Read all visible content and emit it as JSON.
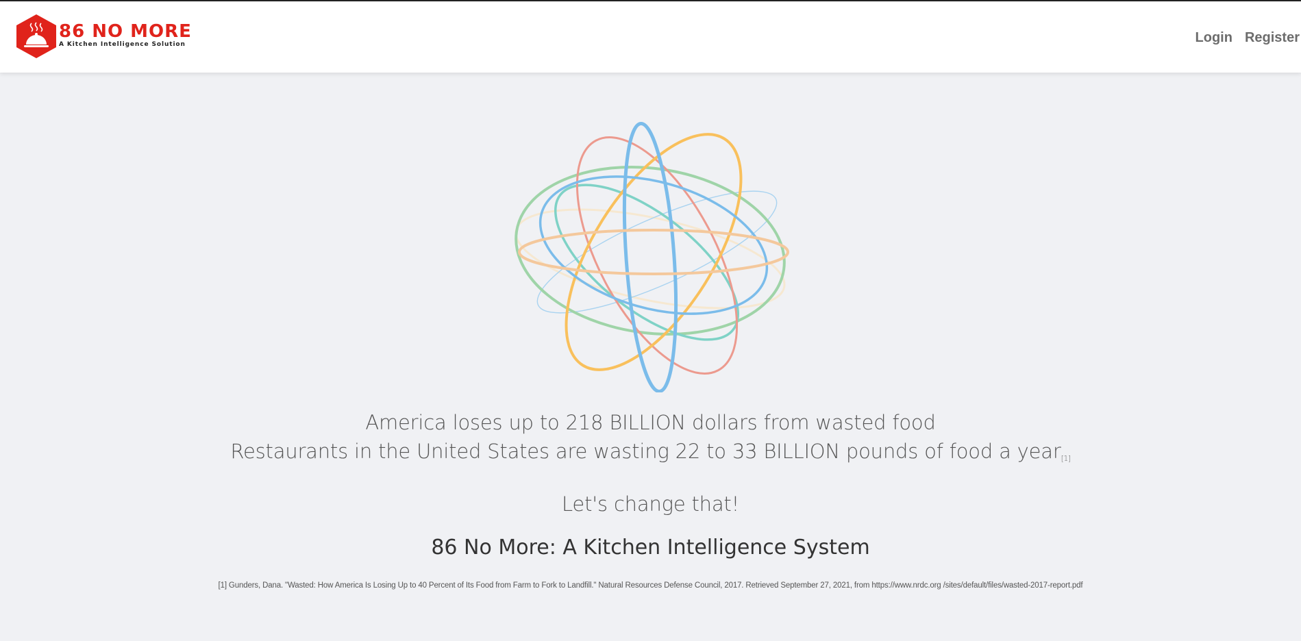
{
  "brand": {
    "name": "86 NO MORE",
    "tagline": "A Kitchen Intelligence Solution",
    "color": "#e0231b"
  },
  "nav": {
    "login_label": "Login",
    "register_label": "Register"
  },
  "hero": {
    "line1": "America loses up to 218 BILLION dollars from wasted food",
    "line2": "Restaurants in the United States are wasting 22 to 33 BILLION pounds of food a year",
    "citation_marker": "[1]",
    "call_to_action": "Let's change that!",
    "system_title": "86 No More: A Kitchen Intelligence System"
  },
  "footnote": "[1] Gunders, Dana. \"Wasted: How America Is Losing Up to 40 Percent of Its Food from Farm to Fork to Landfill.\" Natural Resources Defense Council, 2017. Retrieved September 27, 2021, from https://www.nrdc.org /sites/default/files/wasted-2017-report.pdf",
  "icons": {
    "logo": "cloche-hexagon-icon",
    "animation": "orbit-rings-globe"
  },
  "colors": {
    "ring_blue": "#7bbcea",
    "ring_orange": "#f9c05c",
    "ring_green": "#9fd4a8",
    "ring_red": "#ec9a8e",
    "ring_teal": "#7fd2c6",
    "ring_peach": "#f4c89c"
  }
}
